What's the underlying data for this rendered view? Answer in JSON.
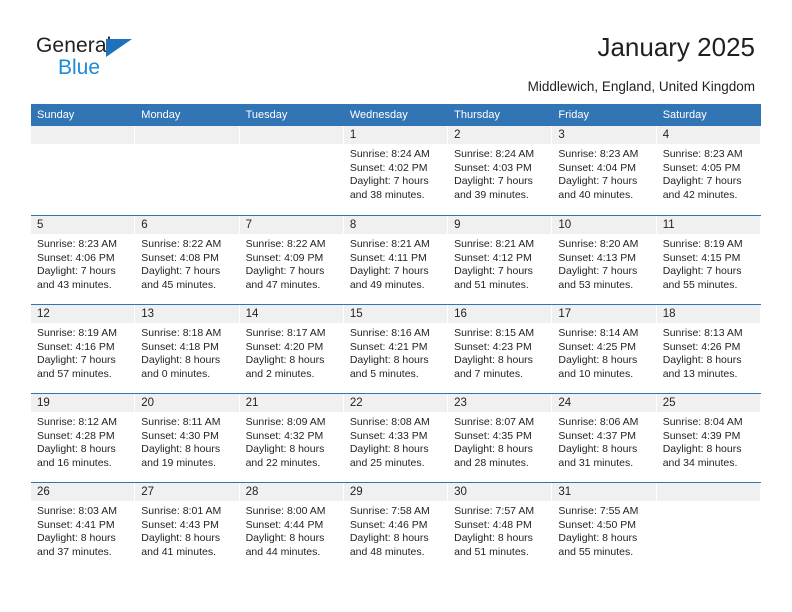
{
  "brand": {
    "name_part1": "General",
    "name_part2": "Blue",
    "accent_color": "#1d72bb",
    "accent_color_light": "#1d8bd8"
  },
  "header": {
    "title": "January 2025",
    "subtitle": "Middlewich, England, United Kingdom",
    "header_bg_color": "#3275b5",
    "daynum_band_color": "#f0f0f0"
  },
  "weekday_headers": [
    "Sunday",
    "Monday",
    "Tuesday",
    "Wednesday",
    "Thursday",
    "Friday",
    "Saturday"
  ],
  "weeks": [
    [
      {
        "day": "",
        "lines": []
      },
      {
        "day": "",
        "lines": []
      },
      {
        "day": "",
        "lines": []
      },
      {
        "day": "1",
        "lines": [
          "Sunrise: 8:24 AM",
          "Sunset: 4:02 PM",
          "Daylight: 7 hours",
          "and 38 minutes."
        ]
      },
      {
        "day": "2",
        "lines": [
          "Sunrise: 8:24 AM",
          "Sunset: 4:03 PM",
          "Daylight: 7 hours",
          "and 39 minutes."
        ]
      },
      {
        "day": "3",
        "lines": [
          "Sunrise: 8:23 AM",
          "Sunset: 4:04 PM",
          "Daylight: 7 hours",
          "and 40 minutes."
        ]
      },
      {
        "day": "4",
        "lines": [
          "Sunrise: 8:23 AM",
          "Sunset: 4:05 PM",
          "Daylight: 7 hours",
          "and 42 minutes."
        ]
      }
    ],
    [
      {
        "day": "5",
        "lines": [
          "Sunrise: 8:23 AM",
          "Sunset: 4:06 PM",
          "Daylight: 7 hours",
          "and 43 minutes."
        ]
      },
      {
        "day": "6",
        "lines": [
          "Sunrise: 8:22 AM",
          "Sunset: 4:08 PM",
          "Daylight: 7 hours",
          "and 45 minutes."
        ]
      },
      {
        "day": "7",
        "lines": [
          "Sunrise: 8:22 AM",
          "Sunset: 4:09 PM",
          "Daylight: 7 hours",
          "and 47 minutes."
        ]
      },
      {
        "day": "8",
        "lines": [
          "Sunrise: 8:21 AM",
          "Sunset: 4:11 PM",
          "Daylight: 7 hours",
          "and 49 minutes."
        ]
      },
      {
        "day": "9",
        "lines": [
          "Sunrise: 8:21 AM",
          "Sunset: 4:12 PM",
          "Daylight: 7 hours",
          "and 51 minutes."
        ]
      },
      {
        "day": "10",
        "lines": [
          "Sunrise: 8:20 AM",
          "Sunset: 4:13 PM",
          "Daylight: 7 hours",
          "and 53 minutes."
        ]
      },
      {
        "day": "11",
        "lines": [
          "Sunrise: 8:19 AM",
          "Sunset: 4:15 PM",
          "Daylight: 7 hours",
          "and 55 minutes."
        ]
      }
    ],
    [
      {
        "day": "12",
        "lines": [
          "Sunrise: 8:19 AM",
          "Sunset: 4:16 PM",
          "Daylight: 7 hours",
          "and 57 minutes."
        ]
      },
      {
        "day": "13",
        "lines": [
          "Sunrise: 8:18 AM",
          "Sunset: 4:18 PM",
          "Daylight: 8 hours",
          "and 0 minutes."
        ]
      },
      {
        "day": "14",
        "lines": [
          "Sunrise: 8:17 AM",
          "Sunset: 4:20 PM",
          "Daylight: 8 hours",
          "and 2 minutes."
        ]
      },
      {
        "day": "15",
        "lines": [
          "Sunrise: 8:16 AM",
          "Sunset: 4:21 PM",
          "Daylight: 8 hours",
          "and 5 minutes."
        ]
      },
      {
        "day": "16",
        "lines": [
          "Sunrise: 8:15 AM",
          "Sunset: 4:23 PM",
          "Daylight: 8 hours",
          "and 7 minutes."
        ]
      },
      {
        "day": "17",
        "lines": [
          "Sunrise: 8:14 AM",
          "Sunset: 4:25 PM",
          "Daylight: 8 hours",
          "and 10 minutes."
        ]
      },
      {
        "day": "18",
        "lines": [
          "Sunrise: 8:13 AM",
          "Sunset: 4:26 PM",
          "Daylight: 8 hours",
          "and 13 minutes."
        ]
      }
    ],
    [
      {
        "day": "19",
        "lines": [
          "Sunrise: 8:12 AM",
          "Sunset: 4:28 PM",
          "Daylight: 8 hours",
          "and 16 minutes."
        ]
      },
      {
        "day": "20",
        "lines": [
          "Sunrise: 8:11 AM",
          "Sunset: 4:30 PM",
          "Daylight: 8 hours",
          "and 19 minutes."
        ]
      },
      {
        "day": "21",
        "lines": [
          "Sunrise: 8:09 AM",
          "Sunset: 4:32 PM",
          "Daylight: 8 hours",
          "and 22 minutes."
        ]
      },
      {
        "day": "22",
        "lines": [
          "Sunrise: 8:08 AM",
          "Sunset: 4:33 PM",
          "Daylight: 8 hours",
          "and 25 minutes."
        ]
      },
      {
        "day": "23",
        "lines": [
          "Sunrise: 8:07 AM",
          "Sunset: 4:35 PM",
          "Daylight: 8 hours",
          "and 28 minutes."
        ]
      },
      {
        "day": "24",
        "lines": [
          "Sunrise: 8:06 AM",
          "Sunset: 4:37 PM",
          "Daylight: 8 hours",
          "and 31 minutes."
        ]
      },
      {
        "day": "25",
        "lines": [
          "Sunrise: 8:04 AM",
          "Sunset: 4:39 PM",
          "Daylight: 8 hours",
          "and 34 minutes."
        ]
      }
    ],
    [
      {
        "day": "26",
        "lines": [
          "Sunrise: 8:03 AM",
          "Sunset: 4:41 PM",
          "Daylight: 8 hours",
          "and 37 minutes."
        ]
      },
      {
        "day": "27",
        "lines": [
          "Sunrise: 8:01 AM",
          "Sunset: 4:43 PM",
          "Daylight: 8 hours",
          "and 41 minutes."
        ]
      },
      {
        "day": "28",
        "lines": [
          "Sunrise: 8:00 AM",
          "Sunset: 4:44 PM",
          "Daylight: 8 hours",
          "and 44 minutes."
        ]
      },
      {
        "day": "29",
        "lines": [
          "Sunrise: 7:58 AM",
          "Sunset: 4:46 PM",
          "Daylight: 8 hours",
          "and 48 minutes."
        ]
      },
      {
        "day": "30",
        "lines": [
          "Sunrise: 7:57 AM",
          "Sunset: 4:48 PM",
          "Daylight: 8 hours",
          "and 51 minutes."
        ]
      },
      {
        "day": "31",
        "lines": [
          "Sunrise: 7:55 AM",
          "Sunset: 4:50 PM",
          "Daylight: 8 hours",
          "and 55 minutes."
        ]
      },
      {
        "day": "",
        "lines": []
      }
    ]
  ]
}
